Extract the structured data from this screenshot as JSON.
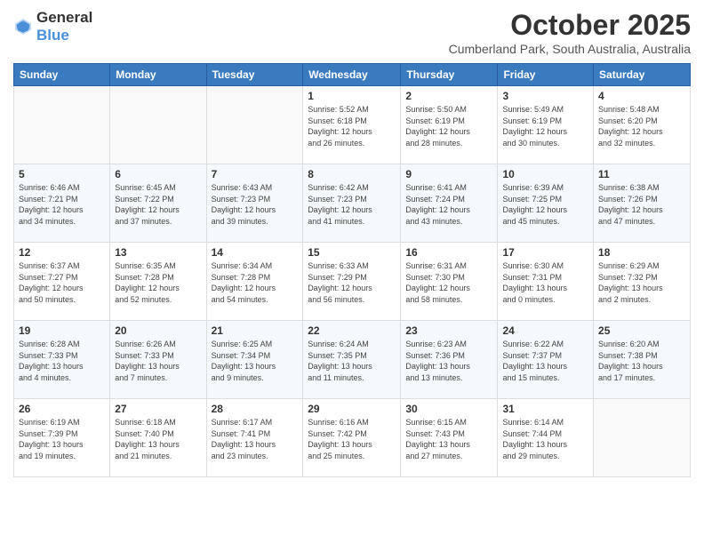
{
  "header": {
    "logo_general": "General",
    "logo_blue": "Blue",
    "title": "October 2025",
    "subtitle": "Cumberland Park, South Australia, Australia"
  },
  "calendar": {
    "days_of_week": [
      "Sunday",
      "Monday",
      "Tuesday",
      "Wednesday",
      "Thursday",
      "Friday",
      "Saturday"
    ],
    "weeks": [
      [
        {
          "day": "",
          "info": ""
        },
        {
          "day": "",
          "info": ""
        },
        {
          "day": "",
          "info": ""
        },
        {
          "day": "1",
          "info": "Sunrise: 5:52 AM\nSunset: 6:18 PM\nDaylight: 12 hours\nand 26 minutes."
        },
        {
          "day": "2",
          "info": "Sunrise: 5:50 AM\nSunset: 6:19 PM\nDaylight: 12 hours\nand 28 minutes."
        },
        {
          "day": "3",
          "info": "Sunrise: 5:49 AM\nSunset: 6:19 PM\nDaylight: 12 hours\nand 30 minutes."
        },
        {
          "day": "4",
          "info": "Sunrise: 5:48 AM\nSunset: 6:20 PM\nDaylight: 12 hours\nand 32 minutes."
        }
      ],
      [
        {
          "day": "5",
          "info": "Sunrise: 6:46 AM\nSunset: 7:21 PM\nDaylight: 12 hours\nand 34 minutes."
        },
        {
          "day": "6",
          "info": "Sunrise: 6:45 AM\nSunset: 7:22 PM\nDaylight: 12 hours\nand 37 minutes."
        },
        {
          "day": "7",
          "info": "Sunrise: 6:43 AM\nSunset: 7:23 PM\nDaylight: 12 hours\nand 39 minutes."
        },
        {
          "day": "8",
          "info": "Sunrise: 6:42 AM\nSunset: 7:23 PM\nDaylight: 12 hours\nand 41 minutes."
        },
        {
          "day": "9",
          "info": "Sunrise: 6:41 AM\nSunset: 7:24 PM\nDaylight: 12 hours\nand 43 minutes."
        },
        {
          "day": "10",
          "info": "Sunrise: 6:39 AM\nSunset: 7:25 PM\nDaylight: 12 hours\nand 45 minutes."
        },
        {
          "day": "11",
          "info": "Sunrise: 6:38 AM\nSunset: 7:26 PM\nDaylight: 12 hours\nand 47 minutes."
        }
      ],
      [
        {
          "day": "12",
          "info": "Sunrise: 6:37 AM\nSunset: 7:27 PM\nDaylight: 12 hours\nand 50 minutes."
        },
        {
          "day": "13",
          "info": "Sunrise: 6:35 AM\nSunset: 7:28 PM\nDaylight: 12 hours\nand 52 minutes."
        },
        {
          "day": "14",
          "info": "Sunrise: 6:34 AM\nSunset: 7:28 PM\nDaylight: 12 hours\nand 54 minutes."
        },
        {
          "day": "15",
          "info": "Sunrise: 6:33 AM\nSunset: 7:29 PM\nDaylight: 12 hours\nand 56 minutes."
        },
        {
          "day": "16",
          "info": "Sunrise: 6:31 AM\nSunset: 7:30 PM\nDaylight: 12 hours\nand 58 minutes."
        },
        {
          "day": "17",
          "info": "Sunrise: 6:30 AM\nSunset: 7:31 PM\nDaylight: 13 hours\nand 0 minutes."
        },
        {
          "day": "18",
          "info": "Sunrise: 6:29 AM\nSunset: 7:32 PM\nDaylight: 13 hours\nand 2 minutes."
        }
      ],
      [
        {
          "day": "19",
          "info": "Sunrise: 6:28 AM\nSunset: 7:33 PM\nDaylight: 13 hours\nand 4 minutes."
        },
        {
          "day": "20",
          "info": "Sunrise: 6:26 AM\nSunset: 7:33 PM\nDaylight: 13 hours\nand 7 minutes."
        },
        {
          "day": "21",
          "info": "Sunrise: 6:25 AM\nSunset: 7:34 PM\nDaylight: 13 hours\nand 9 minutes."
        },
        {
          "day": "22",
          "info": "Sunrise: 6:24 AM\nSunset: 7:35 PM\nDaylight: 13 hours\nand 11 minutes."
        },
        {
          "day": "23",
          "info": "Sunrise: 6:23 AM\nSunset: 7:36 PM\nDaylight: 13 hours\nand 13 minutes."
        },
        {
          "day": "24",
          "info": "Sunrise: 6:22 AM\nSunset: 7:37 PM\nDaylight: 13 hours\nand 15 minutes."
        },
        {
          "day": "25",
          "info": "Sunrise: 6:20 AM\nSunset: 7:38 PM\nDaylight: 13 hours\nand 17 minutes."
        }
      ],
      [
        {
          "day": "26",
          "info": "Sunrise: 6:19 AM\nSunset: 7:39 PM\nDaylight: 13 hours\nand 19 minutes."
        },
        {
          "day": "27",
          "info": "Sunrise: 6:18 AM\nSunset: 7:40 PM\nDaylight: 13 hours\nand 21 minutes."
        },
        {
          "day": "28",
          "info": "Sunrise: 6:17 AM\nSunset: 7:41 PM\nDaylight: 13 hours\nand 23 minutes."
        },
        {
          "day": "29",
          "info": "Sunrise: 6:16 AM\nSunset: 7:42 PM\nDaylight: 13 hours\nand 25 minutes."
        },
        {
          "day": "30",
          "info": "Sunrise: 6:15 AM\nSunset: 7:43 PM\nDaylight: 13 hours\nand 27 minutes."
        },
        {
          "day": "31",
          "info": "Sunrise: 6:14 AM\nSunset: 7:44 PM\nDaylight: 13 hours\nand 29 minutes."
        },
        {
          "day": "",
          "info": ""
        }
      ]
    ]
  }
}
